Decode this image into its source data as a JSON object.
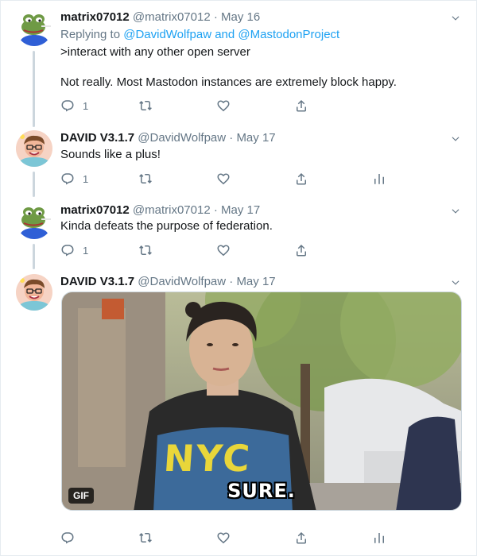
{
  "tweets": [
    {
      "name": "matrix07012",
      "handle": "@matrix07012",
      "separator": "·",
      "date": "May 16",
      "replying_prefix": "Replying to",
      "replying_user1": "@DavidWolfpaw",
      "replying_and": "and",
      "replying_user2": "@MastodonProject",
      "line1": ">interact with any other open server",
      "line2": "Not really. Most Mastodon instances are extremely block happy.",
      "reply_count": "1"
    },
    {
      "name": "DAVID V3.1.7",
      "handle": "@DavidWolfpaw",
      "separator": "·",
      "date": "May 17",
      "line1": "Sounds like a plus!",
      "reply_count": "1"
    },
    {
      "name": "matrix07012",
      "handle": "@matrix07012",
      "separator": "·",
      "date": "May 17",
      "line1": "Kinda defeats the purpose of federation.",
      "reply_count": "1"
    },
    {
      "name": "DAVID V3.1.7",
      "handle": "@DavidWolfpaw",
      "separator": "·",
      "date": "May 17",
      "gif_badge": "GIF",
      "gif_caption": "SURE.",
      "shirt_text": "NYC"
    }
  ],
  "colors": {
    "link": "#1da1f2",
    "secondary_text": "#657786",
    "thread_line": "#ccd6dd"
  },
  "icons": [
    "reply-icon",
    "retweet-icon",
    "like-icon",
    "share-icon",
    "analytics-icon",
    "chevron-down-icon",
    "frog-avatar",
    "cartoon-avatar"
  ]
}
